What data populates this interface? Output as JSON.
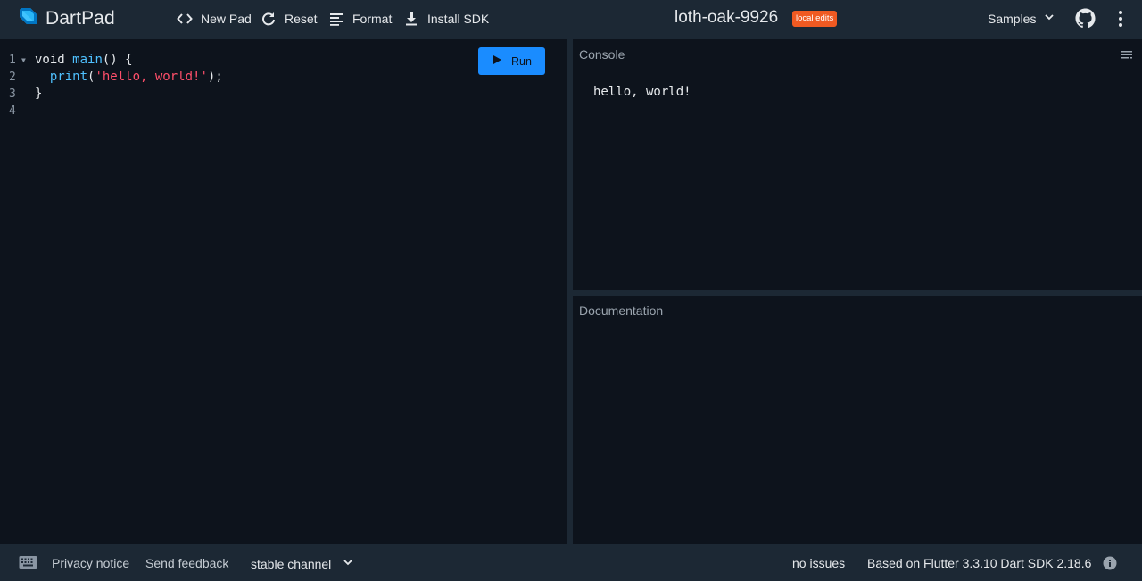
{
  "header": {
    "brand": "DartPad",
    "new_pad": "New Pad",
    "reset": "Reset",
    "format": "Format",
    "install_sdk": "Install SDK",
    "pad_title": "loth-oak-9926",
    "badge": "local edits",
    "samples": "Samples"
  },
  "editor": {
    "line_numbers": [
      "1",
      "2",
      "3",
      "4"
    ],
    "code_lines": [
      {
        "parts": [
          {
            "t": "void ",
            "c": "kw"
          },
          {
            "t": "main",
            "c": "fn"
          },
          {
            "t": "() {",
            "c": "kw"
          }
        ]
      },
      {
        "parts": [
          {
            "t": "  ",
            "c": "kw"
          },
          {
            "t": "print",
            "c": "fn"
          },
          {
            "t": "(",
            "c": "kw"
          },
          {
            "t": "'hello, world!'",
            "c": "str"
          },
          {
            "t": ");",
            "c": "kw"
          }
        ]
      },
      {
        "parts": [
          {
            "t": "}",
            "c": "kw"
          }
        ]
      },
      {
        "parts": []
      }
    ],
    "run_label": "Run"
  },
  "console": {
    "label": "Console",
    "output": "hello, world!"
  },
  "docs": {
    "label": "Documentation"
  },
  "footer": {
    "privacy": "Privacy notice",
    "feedback": "Send feedback",
    "channel": "stable channel",
    "issues": "no issues",
    "version": "Based on Flutter 3.3.10 Dart SDK 2.18.6"
  },
  "colors": {
    "background": "#0d131c",
    "bar": "#1c2834",
    "accent": "#1a8cff",
    "badge": "#f05a22",
    "string": "#ff4f6a",
    "function": "#4fc1ff"
  },
  "icons": [
    "dart-logo-icon",
    "code-brackets-icon",
    "refresh-icon",
    "format-lines-icon",
    "download-icon",
    "chevron-down-icon",
    "github-icon",
    "more-vert-icon",
    "play-icon",
    "clear-console-icon",
    "keyboard-icon",
    "info-icon"
  ]
}
